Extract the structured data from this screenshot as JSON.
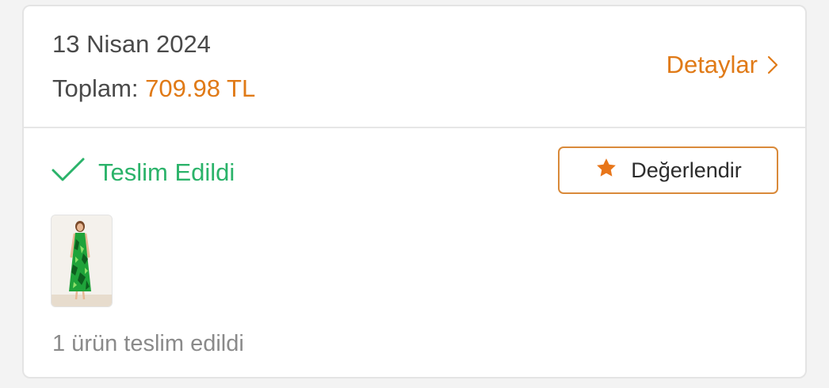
{
  "order": {
    "date": "13 Nisan 2024",
    "total_label": "Toplam:",
    "total_amount": "709.98 TL",
    "details_label": "Detaylar",
    "details_icon": "chevron-right-icon",
    "status_label": "Teslim Edildi",
    "status_icon": "check-icon",
    "rate_label": "Değerlendir",
    "rate_icon": "star-icon",
    "product_image": "product-thumbnail-green-dress",
    "footer_text": "1 ürün teslim edildi"
  },
  "colors": {
    "accent": "#e07a17",
    "success": "#2bb36a",
    "text": "#4a4a4a",
    "muted": "#8a8a8a"
  }
}
